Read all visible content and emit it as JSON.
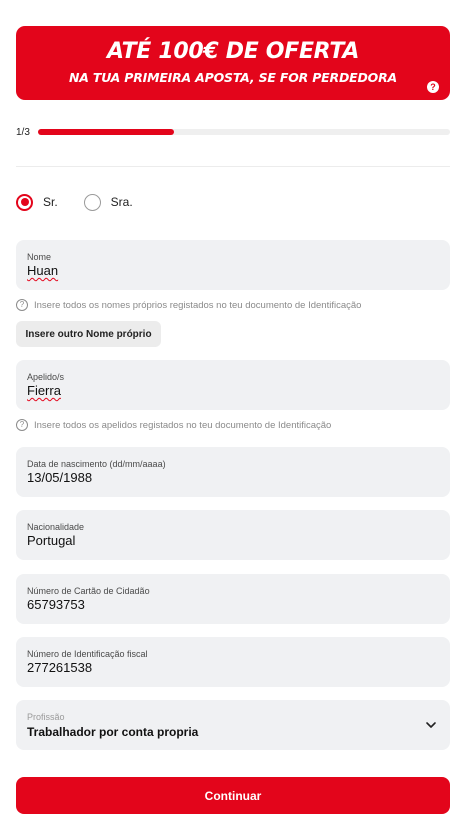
{
  "banner": {
    "title": "ATÉ 100€ DE OFERTA",
    "subtitle": "NA TUA PRIMEIRA APOSTA, SE FOR PERDEDORA",
    "help_glyph": "?"
  },
  "progress": {
    "label": "1/3",
    "fraction": 0.33
  },
  "title_options": [
    {
      "label": "Sr.",
      "selected": true
    },
    {
      "label": "Sra.",
      "selected": false
    }
  ],
  "fields": {
    "nome": {
      "label": "Nome",
      "value": "Huan",
      "hint": "Insere todos os nomes próprios registados no teu documento de Identificação"
    },
    "apelidos": {
      "label": "Apelido/s",
      "value": "Fierra",
      "hint": "Insere todos os apelidos registados no teu documento de Identificação"
    },
    "nascimento": {
      "label": "Data de nascimento (dd/mm/aaaa)",
      "value": "13/05/1988"
    },
    "nacionalidade": {
      "label": "Nacionalidade",
      "value": "Portugal"
    },
    "cartao": {
      "label": "Número de Cartão de Cidadão",
      "value": "65793753"
    },
    "nif": {
      "label": "Número de Identificação fiscal",
      "value": "277261538"
    },
    "profissao": {
      "label": "Profissão",
      "value": "Trabalhador por conta propria",
      "icon": "chevron-down-icon"
    }
  },
  "buttons": {
    "add_name": "Insere outro Nome próprio",
    "continue": "Continuar"
  },
  "hint_glyph": "?",
  "colors": {
    "accent": "#e3051b",
    "field_bg": "#f0f1f3"
  }
}
